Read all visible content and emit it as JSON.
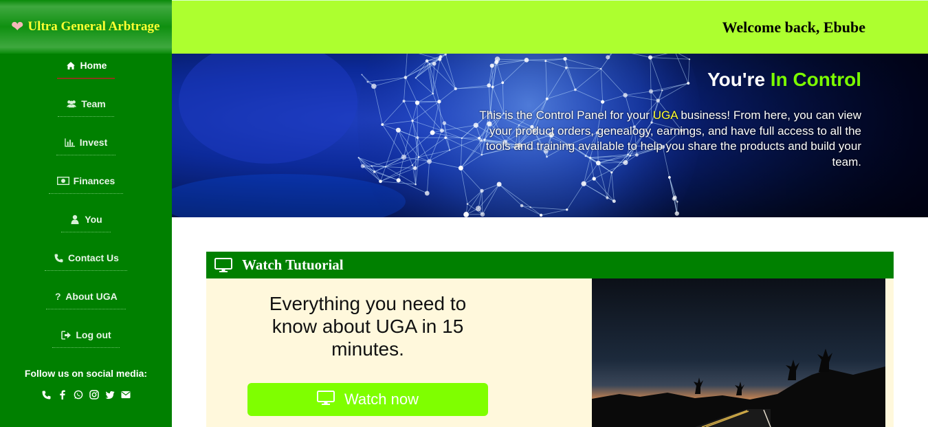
{
  "brand": {
    "name": "Ultra General Arbtrage",
    "icon": "heart-icon"
  },
  "sidebar": {
    "items": [
      {
        "label": "Home",
        "icon": "home-icon",
        "active": true
      },
      {
        "label": "Team",
        "icon": "users-icon",
        "active": false
      },
      {
        "label": "Invest",
        "icon": "bar-chart-icon",
        "active": false
      },
      {
        "label": "Finances",
        "icon": "money-icon",
        "active": false
      },
      {
        "label": "You",
        "icon": "user-icon",
        "active": false
      },
      {
        "label": "Contact Us",
        "icon": "phone-icon",
        "active": false
      },
      {
        "label": "About UGA",
        "icon": "question-icon",
        "active": false
      },
      {
        "label": "Log out",
        "icon": "sign-out-icon",
        "active": false
      }
    ],
    "social_title": "Follow us on social media:",
    "social_icons": [
      "phone-icon",
      "facebook-icon",
      "whatsapp-icon",
      "instagram-icon",
      "twitter-icon",
      "envelope-icon"
    ]
  },
  "header": {
    "welcome": "Welcome back, Ebube"
  },
  "hero": {
    "title_prefix": "You're ",
    "title_accent": "In Control",
    "text_before": "This is the Control Panel for your ",
    "text_accent": "UGA",
    "text_after": " business! From here, you can view your product orders, genealogy, earnings, and have full access to all the tools and training available to help you share the products and build your team."
  },
  "tutorial": {
    "title": "Watch Tutuorial",
    "icon": "monitor-icon",
    "description": "Everything you need to know about UGA in 15 minutes.",
    "button_label": "Watch now"
  },
  "colors": {
    "sidebar": "#008000",
    "header": "#adff2f",
    "brand_text": "#ffff33",
    "accent_green": "#7cfc00",
    "button": "#7fff00",
    "panel_bg": "#fff8dc"
  }
}
